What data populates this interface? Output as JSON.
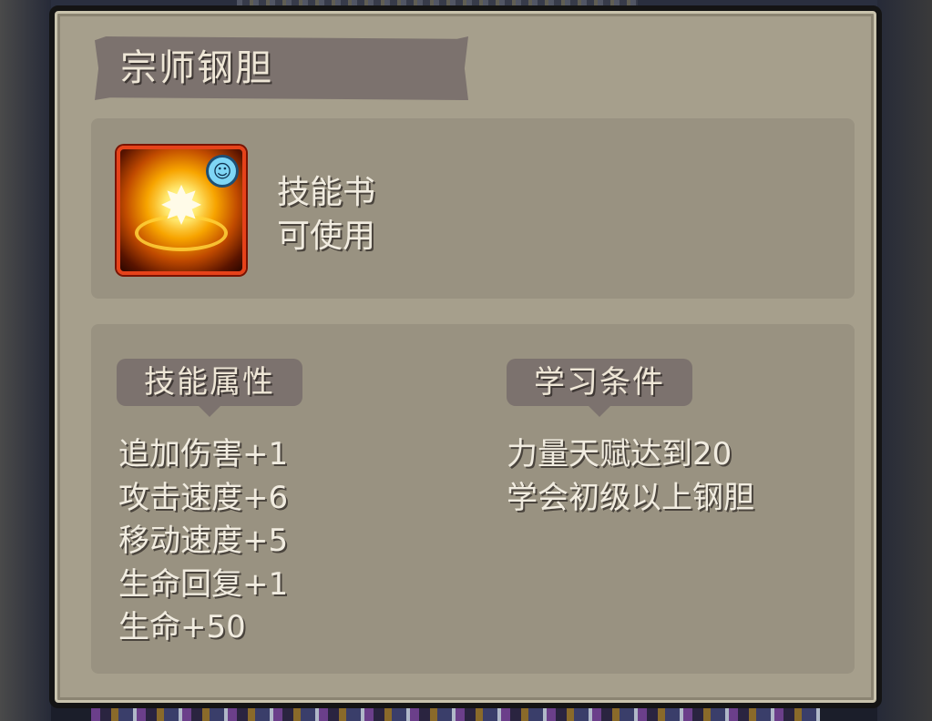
{
  "tooltip": {
    "title": "宗师钢胆",
    "item": {
      "icon": "golden-burst-skill-icon",
      "badge_icon": "person-badge-icon",
      "type_label": "技能书",
      "usable_label": "可使用"
    },
    "attributes": {
      "header": "技能属性",
      "items": [
        "追加伤害+1",
        "攻击速度+6",
        "移动速度+5",
        "生命回复+1",
        "生命+50"
      ]
    },
    "requirements": {
      "header": "学习条件",
      "items": [
        "力量天赋达到20",
        "学会初级以上钢胆"
      ]
    }
  },
  "colors": {
    "panel": "#a69f8c",
    "inner_box": "#999281",
    "banner": "#7c726e",
    "text": "#f1ece0",
    "icon_border": "#e6421a"
  }
}
